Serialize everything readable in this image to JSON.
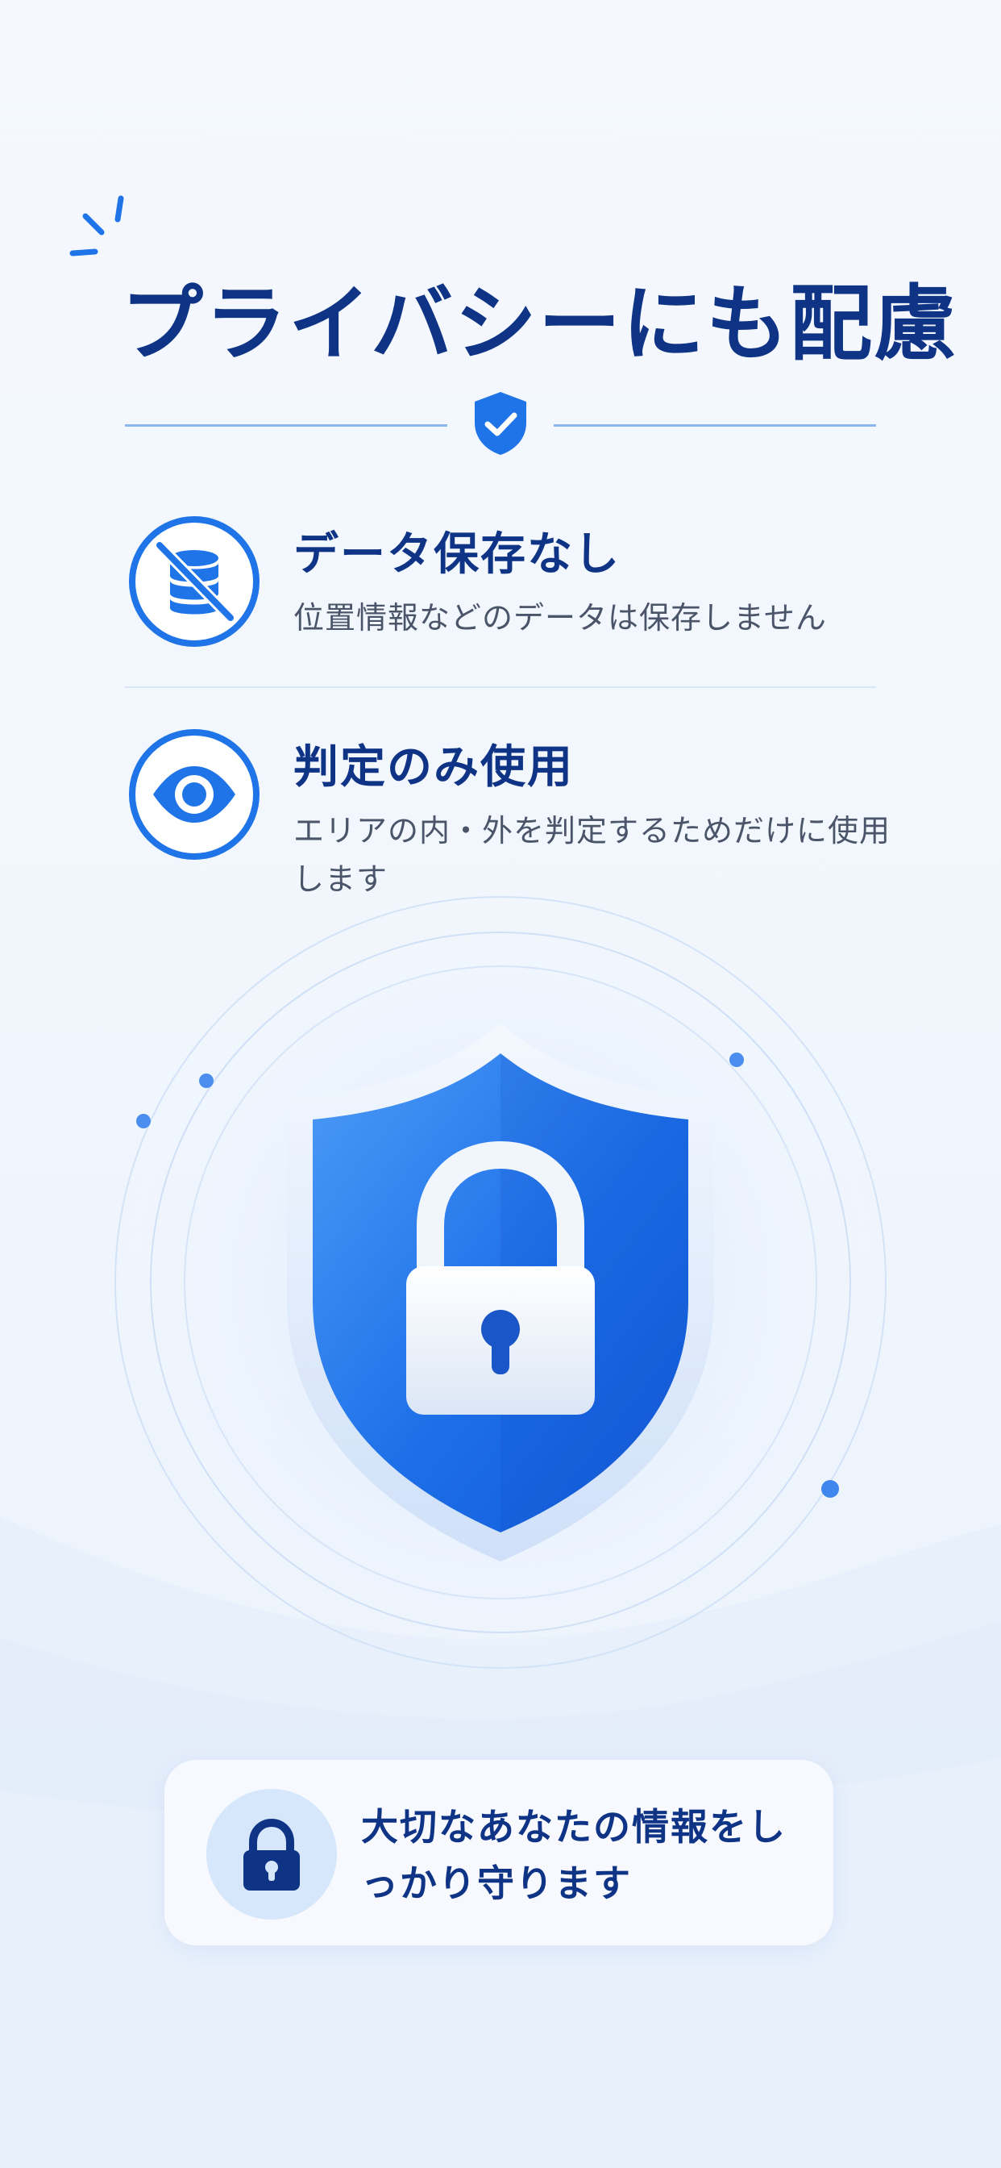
{
  "title": "プライバシーにも配慮",
  "features": [
    {
      "title": "データ保存なし",
      "description": "位置情報などのデータは保存しません",
      "icon": "no-database-icon"
    },
    {
      "title": "判定のみ使用",
      "description": "エリアの内・外を判定するためだけに使用します",
      "icon": "eye-icon"
    }
  ],
  "hero_icon": "shield-lock-icon",
  "footer": {
    "text": "大切なあなたの情報をしっかり守ります",
    "icon": "lock-icon"
  },
  "colors": {
    "primary": "#1f74e8",
    "navy": "#0f3486",
    "text_gray": "#4a556a",
    "background": "#f3f7fd"
  }
}
